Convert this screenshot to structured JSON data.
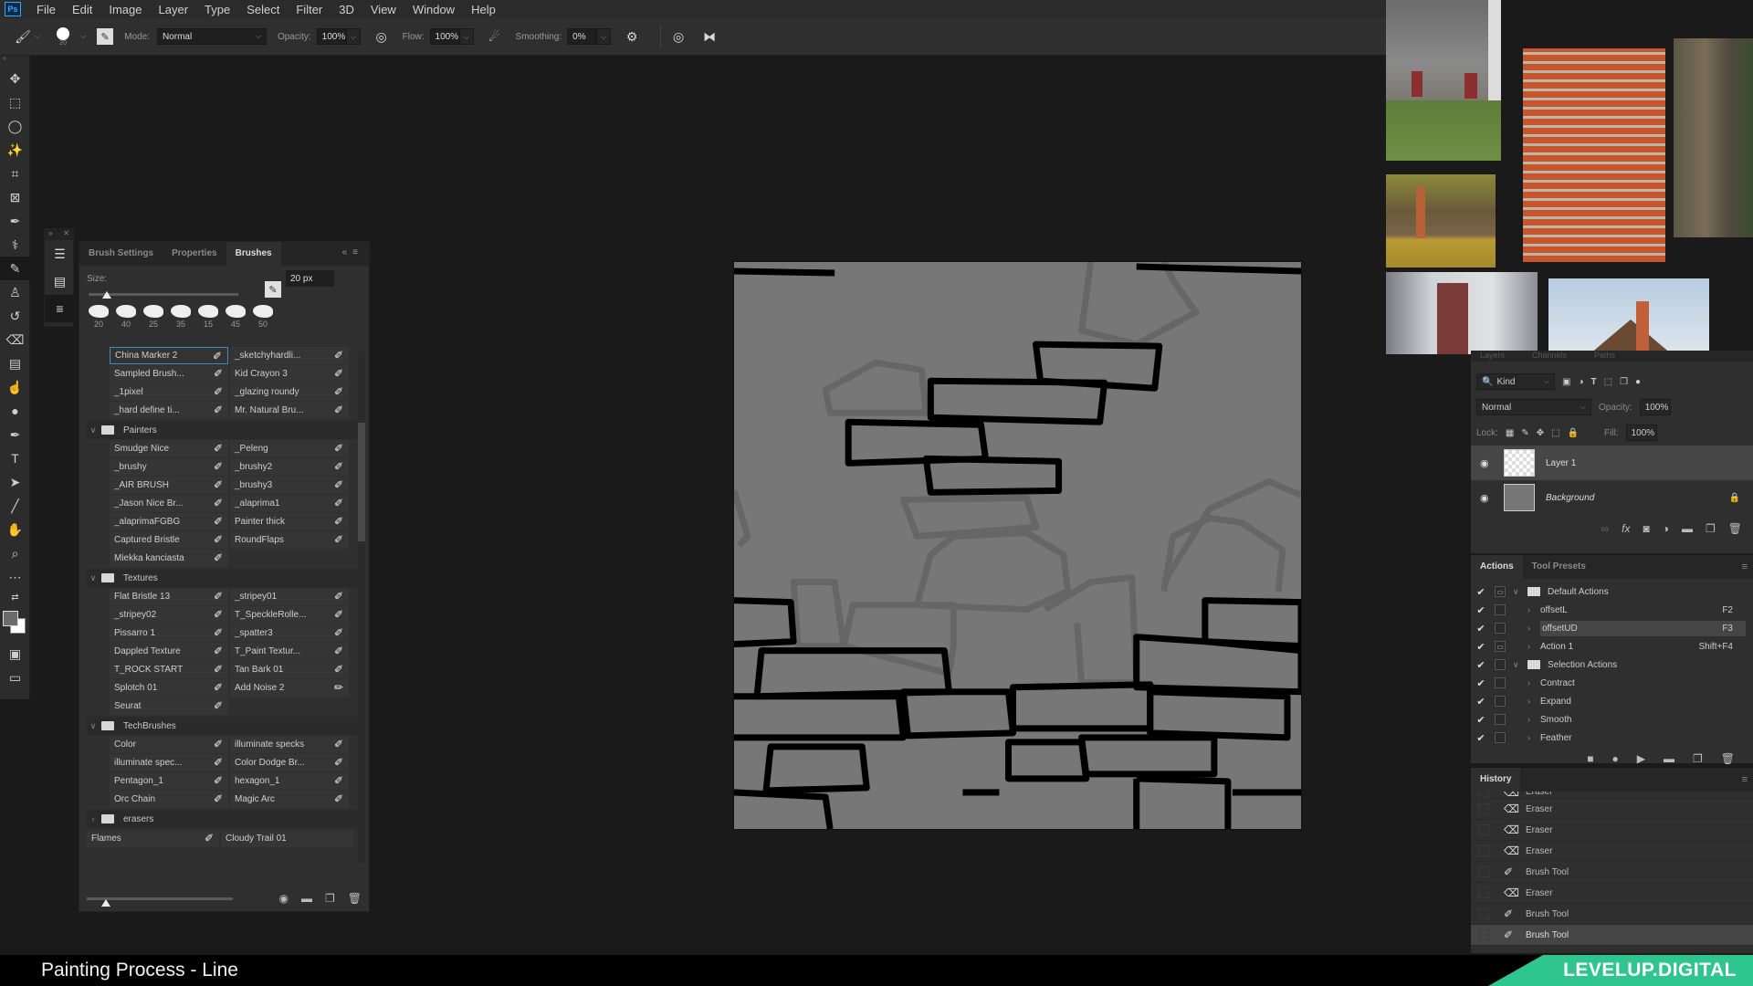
{
  "app": {
    "logo": "Ps"
  },
  "menu": [
    "File",
    "Edit",
    "Image",
    "Layer",
    "Type",
    "Select",
    "Filter",
    "3D",
    "View",
    "Window",
    "Help"
  ],
  "options": {
    "brush_size_label": "20",
    "mode_label": "Mode:",
    "mode_value": "Normal",
    "opacity_label": "Opacity:",
    "opacity_value": "100%",
    "flow_label": "Flow:",
    "flow_value": "100%",
    "smoothing_label": "Smoothing:",
    "smoothing_value": "0%"
  },
  "tools": [
    "move",
    "marquee",
    "lasso",
    "magic-wand",
    "crop",
    "frame",
    "eyedropper",
    "healing",
    "brush",
    "stamp",
    "history-brush",
    "eraser",
    "gradient",
    "smudge",
    "dodge",
    "pen",
    "type",
    "path-select",
    "line",
    "hand",
    "zoom",
    "more"
  ],
  "brushes_panel": {
    "tabs": [
      "Brush Settings",
      "Properties",
      "Brushes"
    ],
    "active_tab": "Brushes",
    "size_label": "Size:",
    "size_value": "20 px",
    "size_fraction": 0.04,
    "recent_sizes": [
      "20",
      "40",
      "25",
      "35",
      "15",
      "45",
      "50"
    ],
    "top_rows": [
      [
        "China Marker 2",
        "_sketchyhardli..."
      ],
      [
        "Sampled Brush...",
        "Kid Crayon 3"
      ],
      [
        "_1pixel",
        "_glazing roundy"
      ],
      [
        "_hard define ti...",
        "Mr. Natural Bru..."
      ]
    ],
    "folders": [
      {
        "name": "Painters",
        "expanded": true,
        "rows": [
          [
            "Smudge Nice",
            "_Peleng"
          ],
          [
            "_brushy",
            "_brushy2"
          ],
          [
            "_AIR BRUSH",
            "_brushy3"
          ],
          [
            "_Jason Nice Br...",
            "_alaprima1"
          ],
          [
            "_alaprimaFGBG",
            "Painter thick"
          ],
          [
            "Captured Bristle",
            "RoundFlaps"
          ],
          [
            "Miekka kanciasta",
            ""
          ]
        ]
      },
      {
        "name": "Textures",
        "expanded": true,
        "rows": [
          [
            "Flat Bristle 13",
            "_stripey01"
          ],
          [
            "_stripey02",
            "T_SpeckleRolle..."
          ],
          [
            "Pissarro 1",
            "_spatter3"
          ],
          [
            "Dappled Texture",
            "T_Paint Textur..."
          ],
          [
            "T_ROCK START",
            "Tan Bark 01"
          ],
          [
            "Splotch 01",
            "Add Noise 2"
          ],
          [
            "Seurat",
            ""
          ]
        ]
      },
      {
        "name": "TechBrushes",
        "expanded": true,
        "rows": [
          [
            "Color",
            "illuminate specks"
          ],
          [
            "illuminate spec...",
            "Color Dodge Br..."
          ],
          [
            "Pentagon_1",
            "hexagon_1"
          ],
          [
            "Orc Chain",
            "Magic Arc"
          ]
        ]
      },
      {
        "name": "erasers",
        "expanded": false,
        "rows": []
      }
    ],
    "loose_row": [
      "Flames",
      "Cloudy Trail 01"
    ]
  },
  "layers_panel": {
    "tabs": [
      "Layers",
      "Channels",
      "Paths"
    ],
    "filter_kind": "Kind",
    "blend_mode": "Normal",
    "opacity_label": "Opacity:",
    "opacity_value": "100%",
    "lock_label": "Lock:",
    "fill_label": "Fill:",
    "fill_value": "100%",
    "layers": [
      {
        "name": "Layer 1",
        "selected": true,
        "visible": true
      },
      {
        "name": "Background",
        "selected": false,
        "visible": true,
        "locked": true
      }
    ]
  },
  "actions_panel": {
    "tabs": [
      "Actions",
      "Tool Presets"
    ],
    "items": [
      {
        "label": "Default Actions",
        "type": "folder",
        "shortcut": ""
      },
      {
        "label": "offsetL",
        "type": "action",
        "shortcut": "F2"
      },
      {
        "label": "offsetUD",
        "type": "action",
        "shortcut": "F3",
        "selected": true
      },
      {
        "label": "Action 1",
        "type": "action",
        "shortcut": "Shift+F4"
      },
      {
        "label": "Selection Actions",
        "type": "folder",
        "shortcut": ""
      },
      {
        "label": "Contract",
        "type": "action",
        "shortcut": ""
      },
      {
        "label": "Expand",
        "type": "action",
        "shortcut": ""
      },
      {
        "label": "Smooth",
        "type": "action",
        "shortcut": ""
      },
      {
        "label": "Feather",
        "type": "action",
        "shortcut": ""
      }
    ]
  },
  "history_panel": {
    "title": "History",
    "items": [
      {
        "label": "Eraser",
        "icon": "eraser"
      },
      {
        "label": "Eraser",
        "icon": "eraser"
      },
      {
        "label": "Eraser",
        "icon": "eraser"
      },
      {
        "label": "Eraser",
        "icon": "eraser"
      },
      {
        "label": "Brush Tool",
        "icon": "brush"
      },
      {
        "label": "Eraser",
        "icon": "eraser"
      },
      {
        "label": "Brush Tool",
        "icon": "brush"
      },
      {
        "label": "Brush Tool",
        "icon": "brush",
        "current": true
      }
    ]
  },
  "caption": {
    "title": "Painting Process - Line",
    "brand": "LEVELUP.DIGITAL"
  },
  "colors": {
    "accent": "#2fc591",
    "selection": "#3b8fc4",
    "canvas_gray": "#777777"
  }
}
